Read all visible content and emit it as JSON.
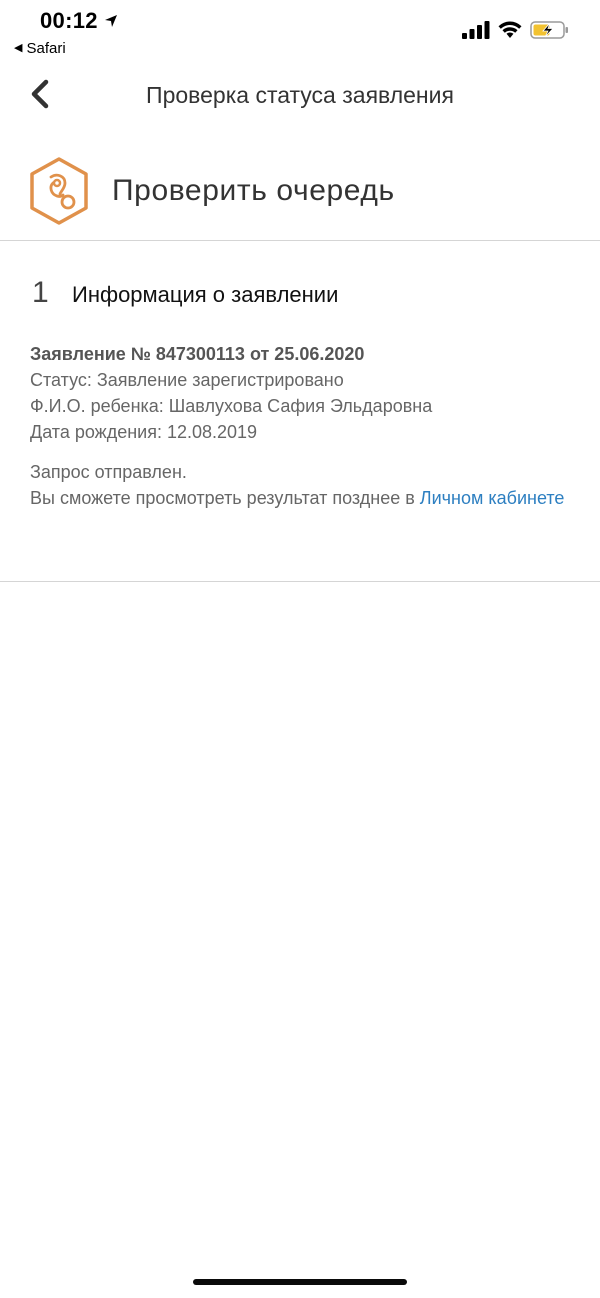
{
  "status_bar": {
    "time": "00:12",
    "back_app_label": "Safari",
    "icons": [
      "location-arrow-icon",
      "signal-icon",
      "wifi-icon",
      "battery-charging-icon"
    ]
  },
  "nav": {
    "title": "Проверка статуса заявления",
    "back_icon": "chevron-left-icon"
  },
  "service": {
    "title": "Проверить очередь",
    "icon": "pacifier-hexagon-icon",
    "accent_color": "#e0914b"
  },
  "section": {
    "step": "1",
    "title": "Информация о заявлении",
    "application": {
      "title": "Заявление № 847300113 от 25.06.2020",
      "status": "Статус: Заявление зарегистрировано",
      "child": "Ф.И.О. ребенка: Шавлухова Сафия Эльдаровна",
      "birth_date": "Дата рождения: 12.08.2019"
    },
    "notice": {
      "line1": "Запрос отправлен.",
      "line2": "Вы сможете просмотреть результат позднее в ",
      "link": "Личном кабинете"
    }
  },
  "colors": {
    "link": "#2d7fc1",
    "accent": "#e0914b"
  }
}
